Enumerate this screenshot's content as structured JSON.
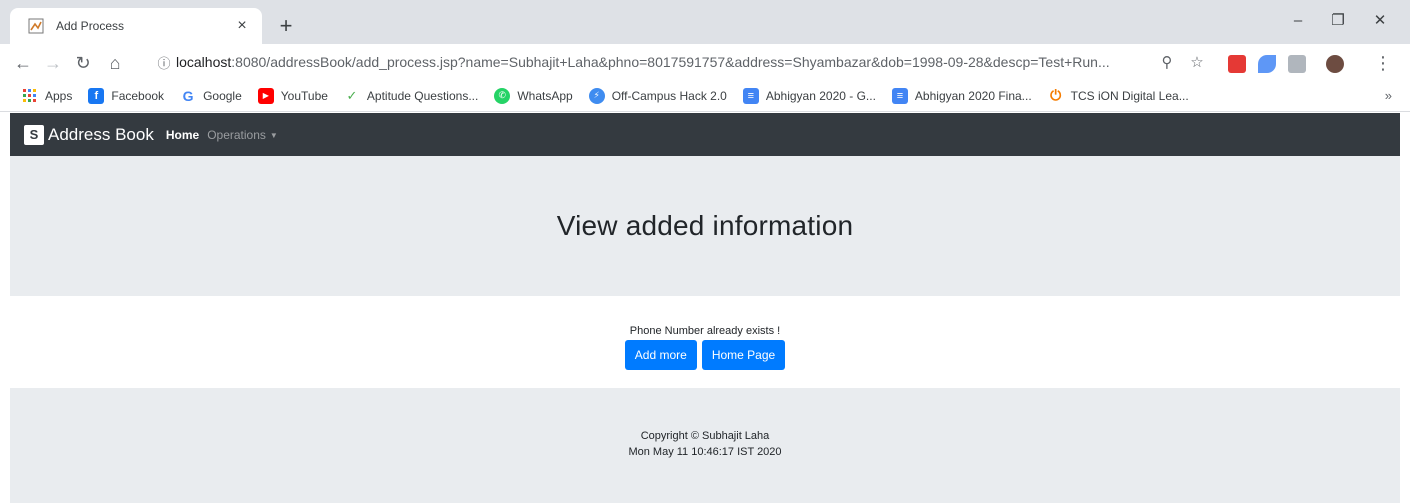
{
  "browser": {
    "tab_title": "Add Process",
    "tab_close": "×",
    "new_tab": "+",
    "window_controls": [
      "–",
      "❐",
      "✕"
    ],
    "url_host": "localhost",
    "url_rest": ":8080/addressBook/add_process.jsp?name=Subhajit+Laha&phno=8017591757&address=Shyambazar&dob=1998-09-28&descp=Test+Run...",
    "bookmarks": [
      {
        "label": "Apps",
        "icon": "apps-grid-icon",
        "color": "#1a73e8"
      },
      {
        "label": "Facebook",
        "icon": "facebook-icon",
        "color": "#1877f2"
      },
      {
        "label": "Google",
        "icon": "google-icon",
        "color": "#ffffff"
      },
      {
        "label": "YouTube",
        "icon": "youtube-icon",
        "color": "#ff0000"
      },
      {
        "label": "Aptitude Questions...",
        "icon": "aptitude-icon",
        "color": "#4caf50"
      },
      {
        "label": "WhatsApp",
        "icon": "whatsapp-icon",
        "color": "#25d366"
      },
      {
        "label": "Off-Campus Hack 2.0",
        "icon": "hack-icon",
        "color": "#3f8cf0"
      },
      {
        "label": "Abhigyan 2020 - G...",
        "icon": "docs-icon",
        "color": "#4285f4"
      },
      {
        "label": "Abhigyan 2020 Fina...",
        "icon": "docs-icon",
        "color": "#4285f4"
      },
      {
        "label": "TCS iON Digital Lea...",
        "icon": "power-icon",
        "color": "#f57c00"
      }
    ],
    "bookmarks_more": "»"
  },
  "navbar": {
    "logo_letter": "S",
    "brand": "Address Book",
    "home": "Home",
    "operations": "Operations",
    "caret": "▼"
  },
  "jumbotron": {
    "title": "View added information"
  },
  "content": {
    "message": "Phone Number already exists !",
    "add_more_label": "Add more",
    "home_page_label": "Home Page"
  },
  "footer": {
    "copyright": "Copyright © Subhajit Laha",
    "timestamp": "Mon May 11 10:46:17 IST 2020"
  },
  "colors": {
    "navbar_bg": "#343a40",
    "jumbotron_bg": "#e9ecef",
    "primary": "#007bff"
  }
}
